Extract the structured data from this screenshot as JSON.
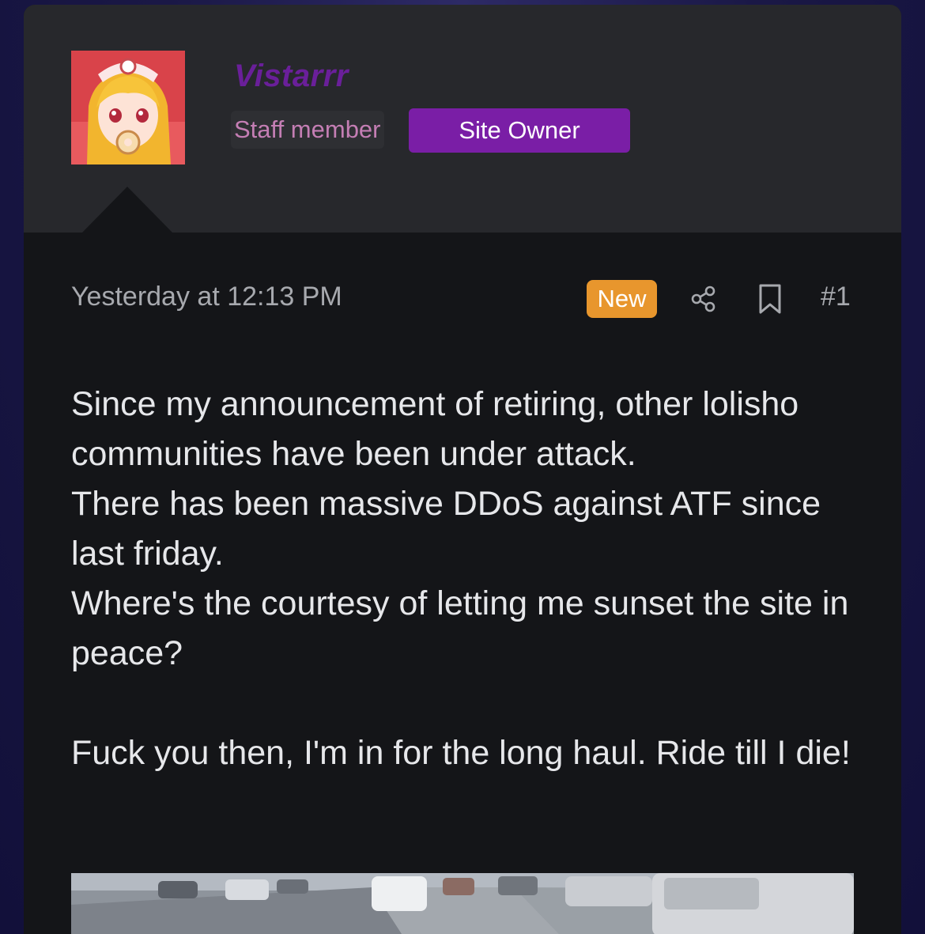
{
  "user": {
    "name": "Vistarrr",
    "staff_badge": "Staff member",
    "role_badge": "Site Owner",
    "name_color": "#6a1f9a",
    "role_badge_color": "#7a1ea6"
  },
  "post": {
    "timestamp": "Yesterday at 12:13 PM",
    "new_badge": "New",
    "new_badge_color": "#e8962d",
    "share_icon": "share-icon",
    "bookmark_icon": "bookmark-icon",
    "number": "#1",
    "lines": [
      "Since my announcement of retiring, other lolisho communities have been under attack.",
      "There has been massive DDoS against ATF since last friday.",
      "Where's the courtesy of letting me sunset the site in peace?",
      "Fuck you then, I'm in for the long haul. Ride till I die!"
    ]
  }
}
